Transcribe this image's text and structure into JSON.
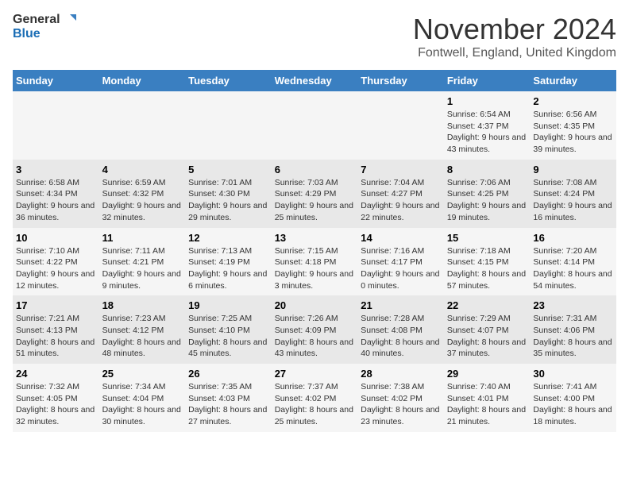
{
  "logo": {
    "general": "General",
    "blue": "Blue"
  },
  "title": "November 2024",
  "location": "Fontwell, England, United Kingdom",
  "days_of_week": [
    "Sunday",
    "Monday",
    "Tuesday",
    "Wednesday",
    "Thursday",
    "Friday",
    "Saturday"
  ],
  "weeks": [
    [
      {
        "day": "",
        "info": ""
      },
      {
        "day": "",
        "info": ""
      },
      {
        "day": "",
        "info": ""
      },
      {
        "day": "",
        "info": ""
      },
      {
        "day": "",
        "info": ""
      },
      {
        "day": "1",
        "info": "Sunrise: 6:54 AM\nSunset: 4:37 PM\nDaylight: 9 hours and 43 minutes."
      },
      {
        "day": "2",
        "info": "Sunrise: 6:56 AM\nSunset: 4:35 PM\nDaylight: 9 hours and 39 minutes."
      }
    ],
    [
      {
        "day": "3",
        "info": "Sunrise: 6:58 AM\nSunset: 4:34 PM\nDaylight: 9 hours and 36 minutes."
      },
      {
        "day": "4",
        "info": "Sunrise: 6:59 AM\nSunset: 4:32 PM\nDaylight: 9 hours and 32 minutes."
      },
      {
        "day": "5",
        "info": "Sunrise: 7:01 AM\nSunset: 4:30 PM\nDaylight: 9 hours and 29 minutes."
      },
      {
        "day": "6",
        "info": "Sunrise: 7:03 AM\nSunset: 4:29 PM\nDaylight: 9 hours and 25 minutes."
      },
      {
        "day": "7",
        "info": "Sunrise: 7:04 AM\nSunset: 4:27 PM\nDaylight: 9 hours and 22 minutes."
      },
      {
        "day": "8",
        "info": "Sunrise: 7:06 AM\nSunset: 4:25 PM\nDaylight: 9 hours and 19 minutes."
      },
      {
        "day": "9",
        "info": "Sunrise: 7:08 AM\nSunset: 4:24 PM\nDaylight: 9 hours and 16 minutes."
      }
    ],
    [
      {
        "day": "10",
        "info": "Sunrise: 7:10 AM\nSunset: 4:22 PM\nDaylight: 9 hours and 12 minutes."
      },
      {
        "day": "11",
        "info": "Sunrise: 7:11 AM\nSunset: 4:21 PM\nDaylight: 9 hours and 9 minutes."
      },
      {
        "day": "12",
        "info": "Sunrise: 7:13 AM\nSunset: 4:19 PM\nDaylight: 9 hours and 6 minutes."
      },
      {
        "day": "13",
        "info": "Sunrise: 7:15 AM\nSunset: 4:18 PM\nDaylight: 9 hours and 3 minutes."
      },
      {
        "day": "14",
        "info": "Sunrise: 7:16 AM\nSunset: 4:17 PM\nDaylight: 9 hours and 0 minutes."
      },
      {
        "day": "15",
        "info": "Sunrise: 7:18 AM\nSunset: 4:15 PM\nDaylight: 8 hours and 57 minutes."
      },
      {
        "day": "16",
        "info": "Sunrise: 7:20 AM\nSunset: 4:14 PM\nDaylight: 8 hours and 54 minutes."
      }
    ],
    [
      {
        "day": "17",
        "info": "Sunrise: 7:21 AM\nSunset: 4:13 PM\nDaylight: 8 hours and 51 minutes."
      },
      {
        "day": "18",
        "info": "Sunrise: 7:23 AM\nSunset: 4:12 PM\nDaylight: 8 hours and 48 minutes."
      },
      {
        "day": "19",
        "info": "Sunrise: 7:25 AM\nSunset: 4:10 PM\nDaylight: 8 hours and 45 minutes."
      },
      {
        "day": "20",
        "info": "Sunrise: 7:26 AM\nSunset: 4:09 PM\nDaylight: 8 hours and 43 minutes."
      },
      {
        "day": "21",
        "info": "Sunrise: 7:28 AM\nSunset: 4:08 PM\nDaylight: 8 hours and 40 minutes."
      },
      {
        "day": "22",
        "info": "Sunrise: 7:29 AM\nSunset: 4:07 PM\nDaylight: 8 hours and 37 minutes."
      },
      {
        "day": "23",
        "info": "Sunrise: 7:31 AM\nSunset: 4:06 PM\nDaylight: 8 hours and 35 minutes."
      }
    ],
    [
      {
        "day": "24",
        "info": "Sunrise: 7:32 AM\nSunset: 4:05 PM\nDaylight: 8 hours and 32 minutes."
      },
      {
        "day": "25",
        "info": "Sunrise: 7:34 AM\nSunset: 4:04 PM\nDaylight: 8 hours and 30 minutes."
      },
      {
        "day": "26",
        "info": "Sunrise: 7:35 AM\nSunset: 4:03 PM\nDaylight: 8 hours and 27 minutes."
      },
      {
        "day": "27",
        "info": "Sunrise: 7:37 AM\nSunset: 4:02 PM\nDaylight: 8 hours and 25 minutes."
      },
      {
        "day": "28",
        "info": "Sunrise: 7:38 AM\nSunset: 4:02 PM\nDaylight: 8 hours and 23 minutes."
      },
      {
        "day": "29",
        "info": "Sunrise: 7:40 AM\nSunset: 4:01 PM\nDaylight: 8 hours and 21 minutes."
      },
      {
        "day": "30",
        "info": "Sunrise: 7:41 AM\nSunset: 4:00 PM\nDaylight: 8 hours and 18 minutes."
      }
    ]
  ]
}
